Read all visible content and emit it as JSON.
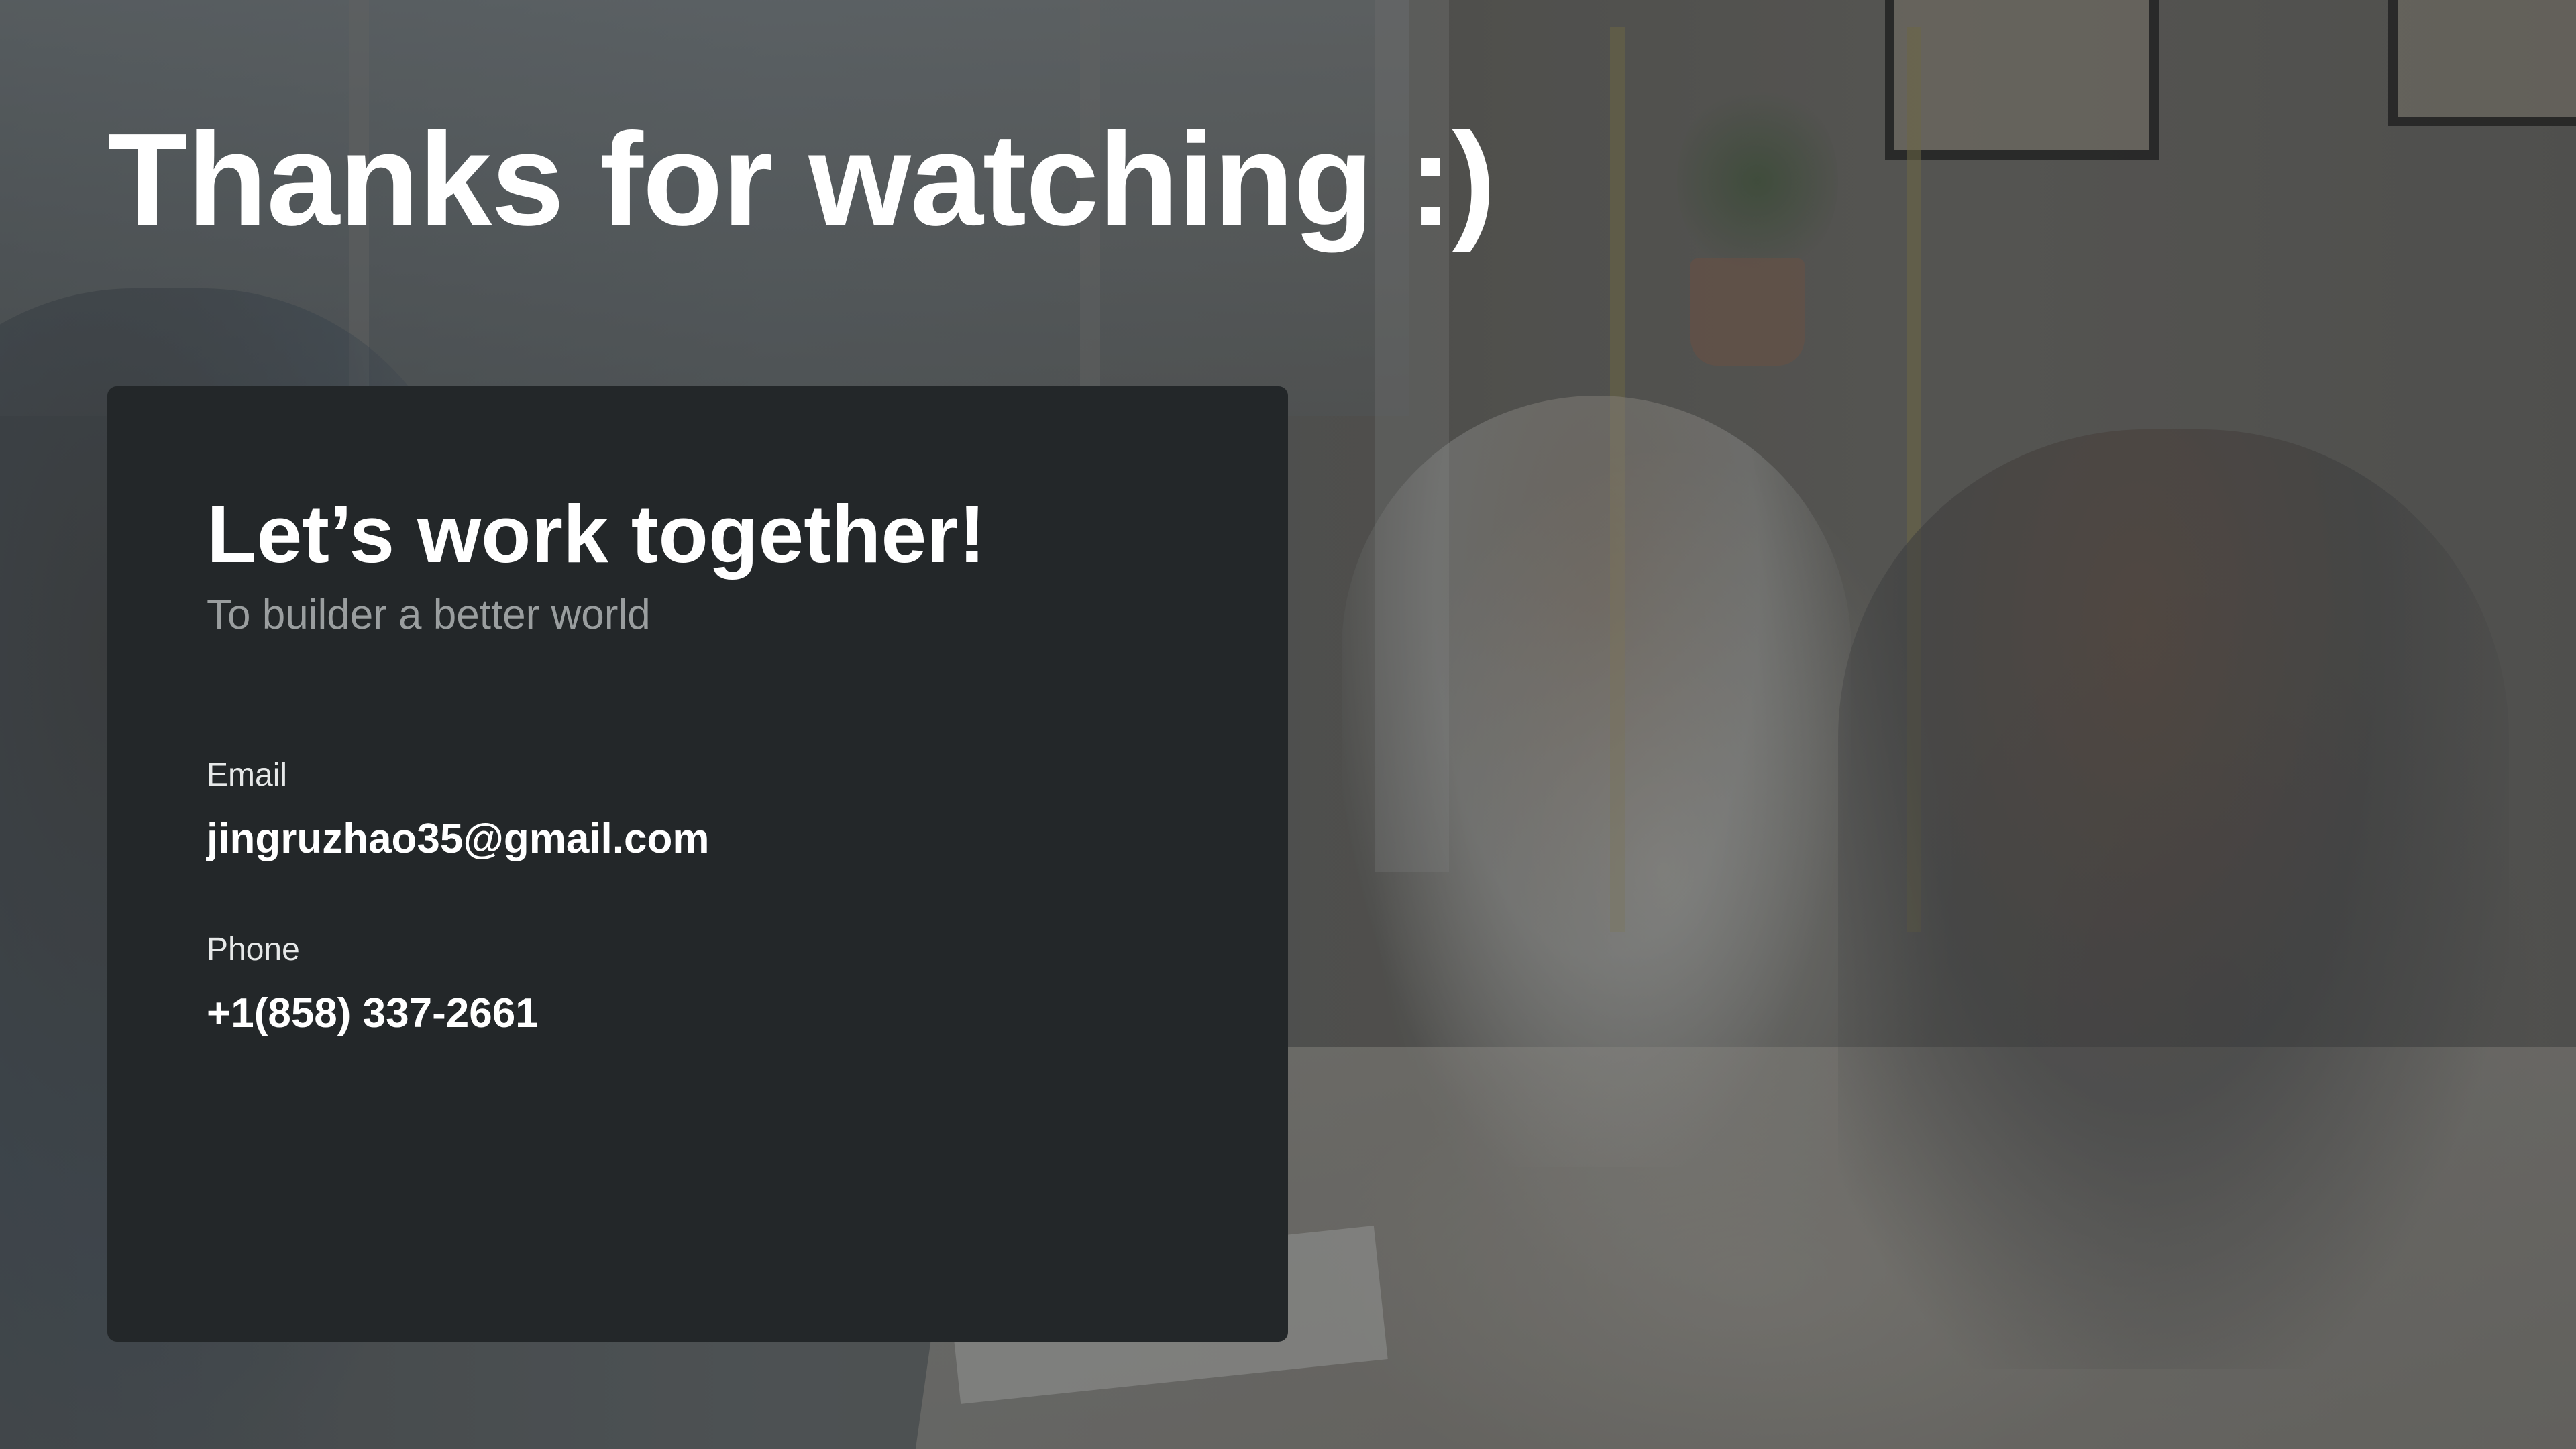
{
  "slide": {
    "title": "Thanks for watching :)",
    "background": {
      "image": "office-meeting-photo",
      "overlay_color": "#23262880"
    },
    "contact_card": {
      "background_color": "#232729",
      "heading": "Let’s work together!",
      "subtitle": "To builder a better world",
      "email": {
        "label": "Email",
        "value": "jingruzhao35@gmail.com"
      },
      "phone": {
        "label": "Phone",
        "value": "+1(858) 337-2661"
      }
    }
  }
}
